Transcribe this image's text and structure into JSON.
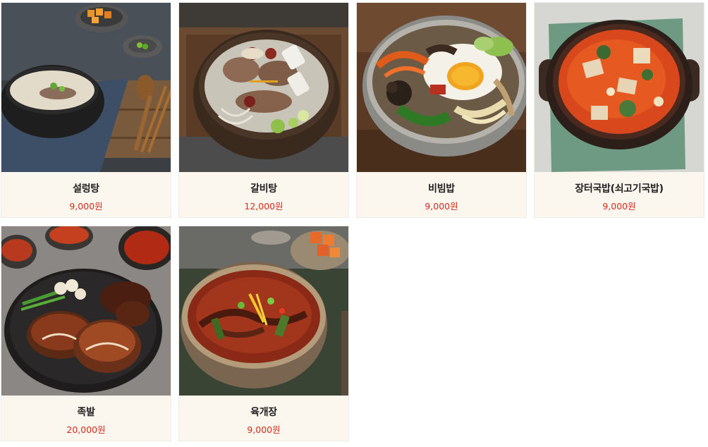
{
  "menu": {
    "items": [
      {
        "name": "설렁탕",
        "price": "9,000원",
        "image": "seolleongtang-photo"
      },
      {
        "name": "갈비탕",
        "price": "12,000원",
        "image": "galbitang-photo"
      },
      {
        "name": "비빔밥",
        "price": "9,000원",
        "image": "bibimbap-photo"
      },
      {
        "name": "장터국밥(쇠고기국밥)",
        "price": "9,000원",
        "image": "gukbap-photo"
      },
      {
        "name": "족발",
        "price": "20,000원",
        "image": "jokbal-photo"
      },
      {
        "name": "육개장",
        "price": "9,000원",
        "image": "yukgaejang-photo"
      }
    ]
  },
  "colors": {
    "price": "#d8291a",
    "card_bg": "#fbf7ef",
    "card_border": "#ececec"
  }
}
